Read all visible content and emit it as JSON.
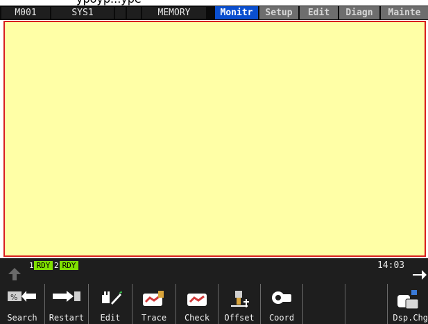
{
  "status": {
    "machine": "M001",
    "system": "SYS1",
    "mode": "MEMORY"
  },
  "tabs": [
    {
      "label": "Monitr",
      "active": true
    },
    {
      "label": "Setup",
      "active": false
    },
    {
      "label": "Edit",
      "active": false
    },
    {
      "label": "Diagn",
      "active": false
    },
    {
      "label": "Mainte",
      "active": false
    }
  ],
  "bottom": {
    "ready": [
      {
        "num": "1",
        "label": "RDY"
      },
      {
        "num": "2",
        "label": "RDY"
      }
    ],
    "clock": "14:03"
  },
  "function_keys": [
    {
      "label": "Search",
      "icon": "search-arrow-icon"
    },
    {
      "label": "Restart",
      "icon": "restart-arrow-icon"
    },
    {
      "label": "Edit",
      "icon": "hand-edit-icon"
    },
    {
      "label": "Trace",
      "icon": "trace-tool-icon"
    },
    {
      "label": "Check",
      "icon": "check-tool-icon"
    },
    {
      "label": "Offset",
      "icon": "tool-offset-icon"
    },
    {
      "label": "Coord",
      "icon": "coordinate-icon"
    },
    {
      "label": "",
      "icon": ""
    },
    {
      "label": "",
      "icon": ""
    },
    {
      "label": "Dsp.Chg",
      "icon": "display-change-icon"
    }
  ],
  "colors": {
    "active_tab": "#0a4fd0",
    "panel_bg": "#ffffa6",
    "panel_border": "#d81e1e",
    "ready": "#7fe000"
  }
}
